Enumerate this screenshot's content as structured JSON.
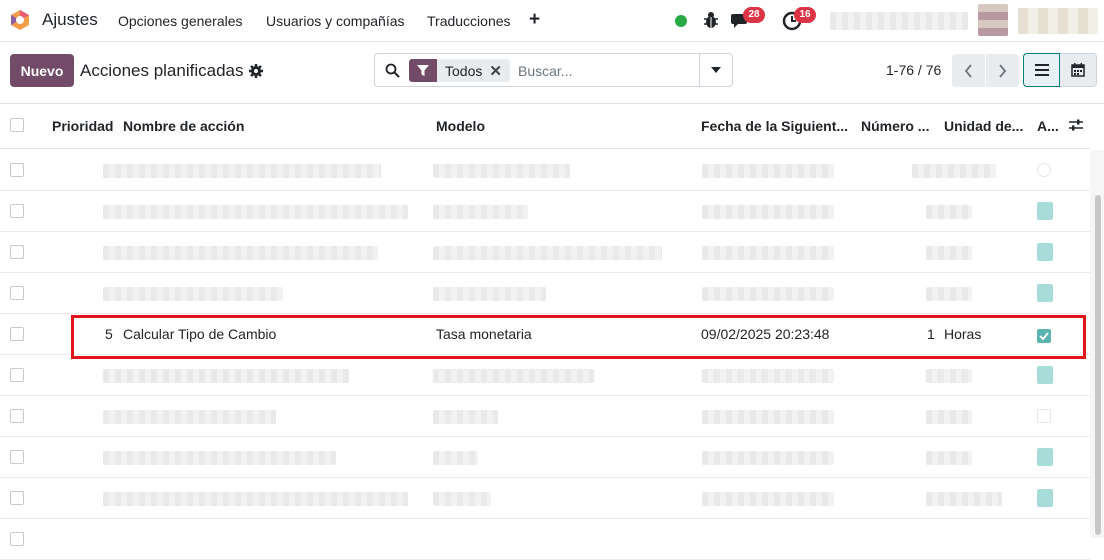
{
  "navbar": {
    "app_name": "Ajustes",
    "menu": [
      "Opciones generales",
      "Usuarios y compañías",
      "Traducciones"
    ],
    "add_label": "+",
    "messages_count": "28",
    "activities_count": "16"
  },
  "control": {
    "new_button": "Nuevo",
    "title": "Acciones planificadas",
    "facet_label": "Todos",
    "search_placeholder": "Buscar...",
    "pager": "1-76 / 76"
  },
  "table": {
    "headers": [
      "Prioridad",
      "Nombre de acción",
      "Modelo",
      "Fecha de la Siguient...",
      "Número ...",
      "Unidad de...",
      "A..."
    ],
    "highlighted_row": {
      "priority": "5",
      "name": "Calcular Tipo de Cambio",
      "model": "Tasa monetaria",
      "next_date": "09/02/2025 20:23:48",
      "number": "1",
      "unit": "Horas",
      "active": true
    }
  },
  "colors": {
    "brand": "#714b67",
    "accent": "#017e84",
    "highlight": "#e3131c",
    "badge": "#dc3545",
    "online": "#28a745"
  }
}
